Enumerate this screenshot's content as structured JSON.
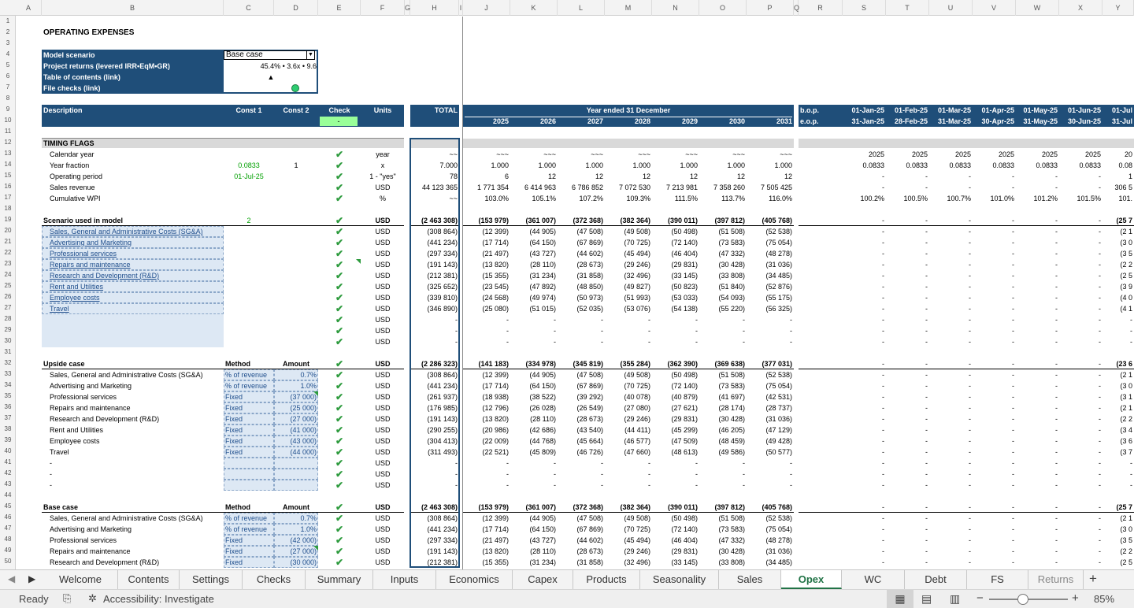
{
  "columns": [
    "A",
    "B",
    "C",
    "D",
    "E",
    "F",
    "G",
    "H",
    "I",
    "J",
    "K",
    "L",
    "M",
    "N",
    "O",
    "P",
    "Q",
    "R",
    "S",
    "T",
    "U",
    "V",
    "W",
    "X",
    "Y"
  ],
  "rows": [
    "1",
    "2",
    "3",
    "4",
    "5",
    "6",
    "7",
    "8",
    "9",
    "10",
    "11",
    "12",
    "13",
    "14",
    "15",
    "16",
    "17",
    "18",
    "19",
    "20",
    "21",
    "22",
    "23",
    "24",
    "25",
    "26",
    "27",
    "28",
    "29",
    "30",
    "31",
    "32",
    "33",
    "34",
    "35",
    "36",
    "37",
    "38",
    "39",
    "40",
    "41",
    "42",
    "43",
    "44",
    "45",
    "46",
    "47",
    "48",
    "49",
    "50"
  ],
  "title": "OPERATING EXPENSES",
  "panel": {
    "model_scenario_label": "Model scenario",
    "model_scenario_value": "Base case",
    "returns_label": "Project returns (levered IRR•EqM•GR)",
    "returns_value": "45.4% • 3.6x • 9.6",
    "toc_label": "Table of contents (link)",
    "toc_value": "▲",
    "checks_label": "File checks (link)"
  },
  "header": {
    "description": "Description",
    "const1": "Const 1",
    "const2": "Const 2",
    "check": "Check",
    "check_value": "-",
    "units": "Units",
    "total": "TOTAL",
    "year_band": "Year ended 31 December",
    "years": [
      "2025",
      "2026",
      "2027",
      "2028",
      "2029",
      "2030",
      "2031"
    ],
    "bop": "b.o.p.",
    "eop": "e.o.p.",
    "bop_dates": [
      "01-Jan-25",
      "01-Feb-25",
      "01-Mar-25",
      "01-Apr-25",
      "01-May-25",
      "01-Jun-25",
      "01-Jul"
    ],
    "eop_dates": [
      "31-Jan-25",
      "28-Feb-25",
      "31-Mar-25",
      "30-Apr-25",
      "31-May-25",
      "30-Jun-25",
      "31-Jul"
    ]
  },
  "timing": {
    "section": "TIMING FLAGS",
    "rows": [
      {
        "label": "Calendar year",
        "c": "",
        "d": "",
        "check": true,
        "units": "year",
        "total": "~~",
        "years": [
          "~~~",
          "~~~",
          "~~~",
          "~~~",
          "~~~",
          "~~~",
          "~~~"
        ],
        "months": [
          "2025",
          "2025",
          "2025",
          "2025",
          "2025",
          "2025",
          "20"
        ]
      },
      {
        "label": "Year fraction",
        "c": "0.0833",
        "d": "1",
        "check": true,
        "units": "x",
        "total": "7.000",
        "years": [
          "1.000",
          "1.000",
          "1.000",
          "1.000",
          "1.000",
          "1.000",
          "1.000"
        ],
        "months": [
          "0.0833",
          "0.0833",
          "0.0833",
          "0.0833",
          "0.0833",
          "0.0833",
          "0.08"
        ]
      },
      {
        "label": "Operating period",
        "c": "01-Jul-25",
        "d": "",
        "check": true,
        "units": "1 - \"yes\"",
        "total": "78",
        "years": [
          "6",
          "12",
          "12",
          "12",
          "12",
          "12",
          "12"
        ],
        "months": [
          "-",
          "-",
          "-",
          "-",
          "-",
          "-",
          "1"
        ]
      },
      {
        "label": "Sales revenue",
        "c": "",
        "d": "",
        "check": true,
        "units": "USD",
        "total": "44 123 365",
        "years": [
          "1 771 354",
          "6 414 963",
          "6 786 852",
          "7 072 530",
          "7 213 981",
          "7 358 260",
          "7 505 425"
        ],
        "months": [
          "-",
          "-",
          "-",
          "-",
          "-",
          "-",
          "306 5"
        ]
      },
      {
        "label": "Cumulative WPI",
        "c": "",
        "d": "",
        "check": true,
        "units": "%",
        "total": "~~",
        "years": [
          "103.0%",
          "105.1%",
          "107.2%",
          "109.3%",
          "111.5%",
          "113.7%",
          "116.0%"
        ],
        "months": [
          "100.2%",
          "100.5%",
          "100.7%",
          "101.0%",
          "101.2%",
          "101.5%",
          "101."
        ]
      }
    ]
  },
  "scenario": {
    "label": "Scenario used in model",
    "c": "2",
    "units": "USD",
    "total": "(2 463 308)",
    "years": [
      "(153 979)",
      "(361 007)",
      "(372 368)",
      "(382 364)",
      "(390 011)",
      "(397 812)",
      "(405 768)"
    ],
    "month_last": "(25 7",
    "rows": [
      {
        "label": "Sales, General and Administrative Costs (SG&A)",
        "total": "(308 864)",
        "years": [
          "(12 399)",
          "(44 905)",
          "(47 508)",
          "(49 508)",
          "(50 498)",
          "(51 508)",
          "(52 538)"
        ],
        "last": "(2 1"
      },
      {
        "label": "Advertising and Marketing",
        "total": "(441 234)",
        "years": [
          "(17 714)",
          "(64 150)",
          "(67 869)",
          "(70 725)",
          "(72 140)",
          "(73 583)",
          "(75 054)"
        ],
        "last": "(3 0"
      },
      {
        "label": "Professional services",
        "total": "(297 334)",
        "years": [
          "(21 497)",
          "(43 727)",
          "(44 602)",
          "(45 494)",
          "(46 404)",
          "(47 332)",
          "(48 278)"
        ],
        "last": "(3 5"
      },
      {
        "label": "Repairs and maintenance",
        "total": "(191 143)",
        "years": [
          "(13 820)",
          "(28 110)",
          "(28 673)",
          "(29 246)",
          "(29 831)",
          "(30 428)",
          "(31 036)"
        ],
        "last": "(2 2"
      },
      {
        "label": "Research and Development (R&D)",
        "total": "(212 381)",
        "years": [
          "(15 355)",
          "(31 234)",
          "(31 858)",
          "(32 496)",
          "(33 145)",
          "(33 808)",
          "(34 485)"
        ],
        "last": "(2 5"
      },
      {
        "label": "Rent and Utilities",
        "total": "(325 652)",
        "years": [
          "(23 545)",
          "(47 892)",
          "(48 850)",
          "(49 827)",
          "(50 823)",
          "(51 840)",
          "(52 876)"
        ],
        "last": "(3 9"
      },
      {
        "label": "Employee costs",
        "total": "(339 810)",
        "years": [
          "(24 568)",
          "(49 974)",
          "(50 973)",
          "(51 993)",
          "(53 033)",
          "(54 093)",
          "(55 175)"
        ],
        "last": "(4 0"
      },
      {
        "label": "Travel",
        "total": "(346 890)",
        "years": [
          "(25 080)",
          "(51 015)",
          "(52 035)",
          "(53 076)",
          "(54 138)",
          "(55 220)",
          "(56 325)"
        ],
        "last": "(4 1"
      },
      {
        "label": "",
        "total": "-",
        "years": [
          "-",
          "-",
          "-",
          "-",
          "-",
          "-",
          "-"
        ],
        "last": "-"
      },
      {
        "label": "",
        "total": "-",
        "years": [
          "-",
          "-",
          "-",
          "-",
          "-",
          "-",
          "-"
        ],
        "last": "-"
      },
      {
        "label": "",
        "total": "-",
        "years": [
          "-",
          "-",
          "-",
          "-",
          "-",
          "-",
          "-"
        ],
        "last": "-"
      }
    ]
  },
  "upside": {
    "label": "Upside case",
    "method": "Method",
    "amount": "Amount",
    "units": "USD",
    "total": "(2 286 323)",
    "years": [
      "(141 183)",
      "(334 978)",
      "(345 819)",
      "(355 284)",
      "(362 390)",
      "(369 638)",
      "(377 031)"
    ],
    "month_last": "(23 6",
    "rows": [
      {
        "label": "Sales, General and Administrative Costs (SG&A)",
        "method": "% of revenue",
        "amount": "0.7%",
        "total": "(308 864)",
        "years": [
          "(12 399)",
          "(44 905)",
          "(47 508)",
          "(49 508)",
          "(50 498)",
          "(51 508)",
          "(52 538)"
        ],
        "last": "(2 1"
      },
      {
        "label": "Advertising and Marketing",
        "method": "% of revenue",
        "amount": "1.0%",
        "total": "(441 234)",
        "years": [
          "(17 714)",
          "(64 150)",
          "(67 869)",
          "(70 725)",
          "(72 140)",
          "(73 583)",
          "(75 054)"
        ],
        "last": "(3 0"
      },
      {
        "label": "Professional services",
        "method": "Fixed",
        "amount": "(37 000)",
        "total": "(261 937)",
        "years": [
          "(18 938)",
          "(38 522)",
          "(39 292)",
          "(40 078)",
          "(40 879)",
          "(41 697)",
          "(42 531)"
        ],
        "last": "(3 1"
      },
      {
        "label": "Repairs and maintenance",
        "method": "Fixed",
        "amount": "(25 000)",
        "total": "(176 985)",
        "years": [
          "(12 796)",
          "(26 028)",
          "(26 549)",
          "(27 080)",
          "(27 621)",
          "(28 174)",
          "(28 737)"
        ],
        "last": "(2 1"
      },
      {
        "label": "Research and Development (R&D)",
        "method": "Fixed",
        "amount": "(27 000)",
        "total": "(191 143)",
        "years": [
          "(13 820)",
          "(28 110)",
          "(28 673)",
          "(29 246)",
          "(29 831)",
          "(30 428)",
          "(31 036)"
        ],
        "last": "(2 2"
      },
      {
        "label": "Rent and Utilities",
        "method": "Fixed",
        "amount": "(41 000)",
        "total": "(290 255)",
        "years": [
          "(20 986)",
          "(42 686)",
          "(43 540)",
          "(44 411)",
          "(45 299)",
          "(46 205)",
          "(47 129)"
        ],
        "last": "(3 4"
      },
      {
        "label": "Employee costs",
        "method": "Fixed",
        "amount": "(43 000)",
        "total": "(304 413)",
        "years": [
          "(22 009)",
          "(44 768)",
          "(45 664)",
          "(46 577)",
          "(47 509)",
          "(48 459)",
          "(49 428)"
        ],
        "last": "(3 6"
      },
      {
        "label": "Travel",
        "method": "Fixed",
        "amount": "(44 000)",
        "total": "(311 493)",
        "years": [
          "(22 521)",
          "(45 809)",
          "(46 726)",
          "(47 660)",
          "(48 613)",
          "(49 586)",
          "(50 577)"
        ],
        "last": "(3 7"
      },
      {
        "label": "-",
        "method": "",
        "amount": "",
        "total": "-",
        "years": [
          "-",
          "-",
          "-",
          "-",
          "-",
          "-",
          "-"
        ],
        "last": "-"
      },
      {
        "label": "-",
        "method": "",
        "amount": "",
        "total": "-",
        "years": [
          "-",
          "-",
          "-",
          "-",
          "-",
          "-",
          "-"
        ],
        "last": "-"
      },
      {
        "label": "-",
        "method": "",
        "amount": "",
        "total": "-",
        "years": [
          "-",
          "-",
          "-",
          "-",
          "-",
          "-",
          "-"
        ],
        "last": "-"
      }
    ]
  },
  "base": {
    "label": "Base case",
    "method": "Method",
    "amount": "Amount",
    "units": "USD",
    "total": "(2 463 308)",
    "years": [
      "(153 979)",
      "(361 007)",
      "(372 368)",
      "(382 364)",
      "(390 011)",
      "(397 812)",
      "(405 768)"
    ],
    "month_last": "(25 7",
    "rows": [
      {
        "label": "Sales, General and Administrative Costs (SG&A)",
        "method": "% of revenue",
        "amount": "0.7%",
        "total": "(308 864)",
        "years": [
          "(12 399)",
          "(44 905)",
          "(47 508)",
          "(49 508)",
          "(50 498)",
          "(51 508)",
          "(52 538)"
        ],
        "last": "(2 1"
      },
      {
        "label": "Advertising and Marketing",
        "method": "% of revenue",
        "amount": "1.0%",
        "total": "(441 234)",
        "years": [
          "(17 714)",
          "(64 150)",
          "(67 869)",
          "(70 725)",
          "(72 140)",
          "(73 583)",
          "(75 054)"
        ],
        "last": "(3 0"
      },
      {
        "label": "Professional services",
        "method": "Fixed",
        "amount": "(42 000)",
        "total": "(297 334)",
        "years": [
          "(21 497)",
          "(43 727)",
          "(44 602)",
          "(45 494)",
          "(46 404)",
          "(47 332)",
          "(48 278)"
        ],
        "last": "(3 5"
      },
      {
        "label": "Repairs and maintenance",
        "method": "Fixed",
        "amount": "(27 000)",
        "total": "(191 143)",
        "years": [
          "(13 820)",
          "(28 110)",
          "(28 673)",
          "(29 246)",
          "(29 831)",
          "(30 428)",
          "(31 036)"
        ],
        "last": "(2 2"
      },
      {
        "label": "Research and Development (R&D)",
        "method": "Fixed",
        "amount": "(30 000)",
        "total": "(212 381)",
        "years": [
          "(15 355)",
          "(31 234)",
          "(31 858)",
          "(32 496)",
          "(33 145)",
          "(33 808)",
          "(34 485)"
        ],
        "last": "(2 5"
      }
    ]
  },
  "tabs": [
    "Welcome",
    "Contents",
    "Settings",
    "Checks",
    "Summary",
    "Inputs",
    "Economics",
    "Capex",
    "Products",
    "Seasonality",
    "Sales",
    "Opex",
    "WC",
    "Debt",
    "FS",
    "Returns"
  ],
  "active_tab": "Opex",
  "status": {
    "ready": "Ready",
    "accessibility": "Accessibility: Investigate",
    "zoom": "85%"
  }
}
